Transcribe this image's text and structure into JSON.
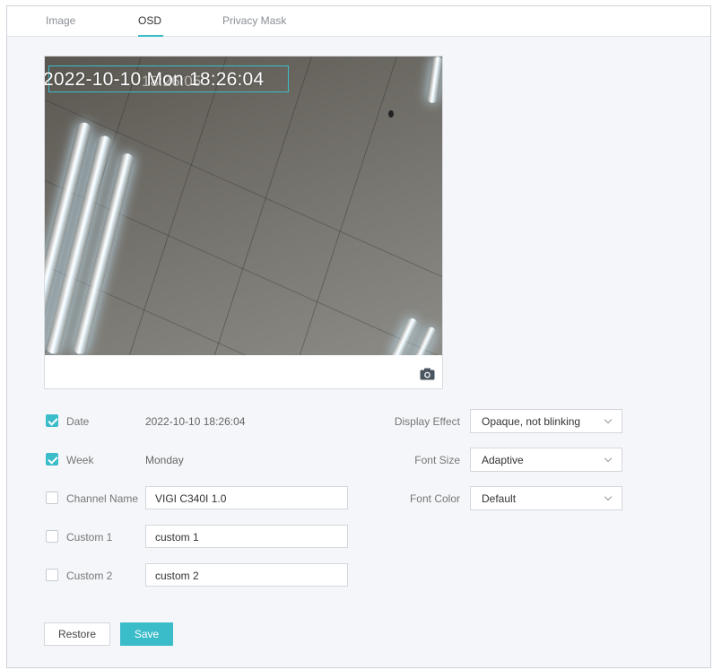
{
  "tabs": [
    {
      "label": "Image",
      "active": false
    },
    {
      "label": "OSD",
      "active": true
    },
    {
      "label": "Privacy Mask",
      "active": false
    }
  ],
  "preview": {
    "osd_overlay_text": "2022-10-10 Mon 18:26:04",
    "osd_ghost_text": "18:26:05",
    "snapshot_icon": "camera-icon"
  },
  "fields": {
    "date": {
      "label": "Date",
      "checked": true,
      "value": "2022-10-10 18:26:04"
    },
    "week": {
      "label": "Week",
      "checked": true,
      "value": "Monday"
    },
    "channel_name": {
      "label": "Channel Name",
      "checked": false,
      "value": "VIGI C340I 1.0"
    },
    "custom1": {
      "label": "Custom 1",
      "checked": false,
      "value": "custom 1"
    },
    "custom2": {
      "label": "Custom 2",
      "checked": false,
      "value": "custom 2"
    }
  },
  "settings": {
    "display_effect": {
      "label": "Display Effect",
      "value": "Opaque, not blinking"
    },
    "font_size": {
      "label": "Font Size",
      "value": "Adaptive"
    },
    "font_color": {
      "label": "Font Color",
      "value": "Default"
    }
  },
  "buttons": {
    "restore": "Restore",
    "save": "Save"
  },
  "colors": {
    "accent": "#3bbcc9"
  }
}
